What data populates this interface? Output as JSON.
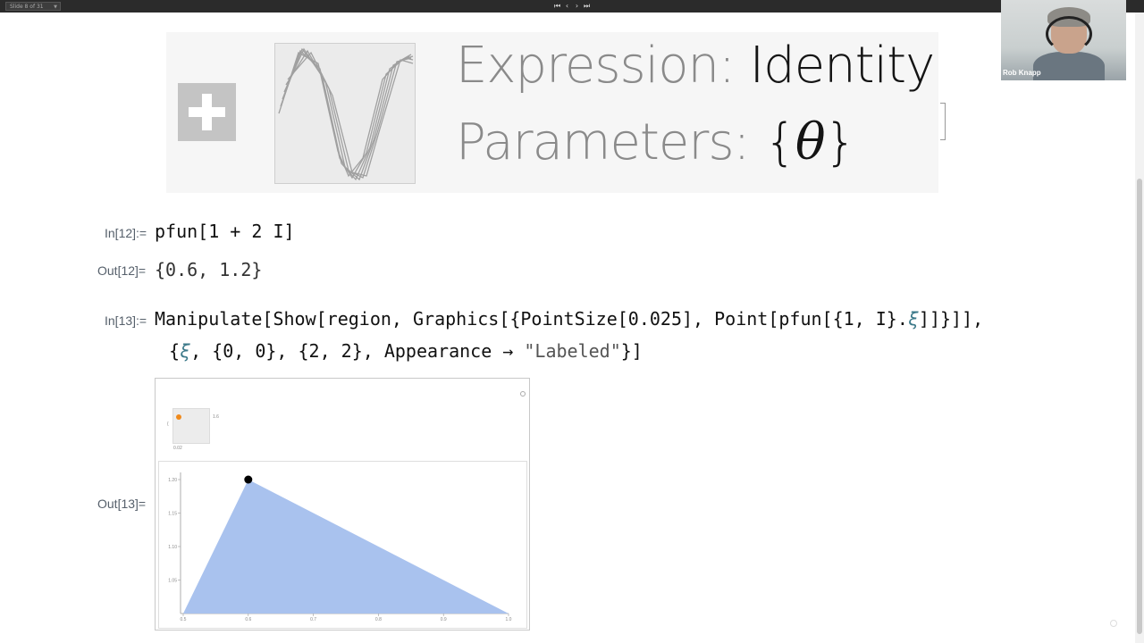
{
  "topbar": {
    "slide_selector": "Slide 8 of 31",
    "nav": [
      "first",
      "previous",
      "next",
      "last"
    ]
  },
  "webcam": {
    "name": "Rob Knapp"
  },
  "banner": {
    "expression_key": "Expression: ",
    "expression_value": "Identity",
    "parameters_key": "Parameters: ",
    "parameters_value_open": "{",
    "parameters_value_symbol": "θ",
    "parameters_value_close": "}"
  },
  "cells": {
    "in12": {
      "label": "In[12]:=",
      "code": "pfun[1 + 2 I]"
    },
    "out12": {
      "label": "Out[12]=",
      "value": "{0.6, 1.2}"
    },
    "in13": {
      "label": "In[13]:=",
      "line1_a": "Manipulate[Show[region, Graphics[{PointSize[0.025], Point[pfun[{1, I}.",
      "line1_xi": "ξ",
      "line1_b": "]]}]],",
      "line2_a": "{",
      "line2_xi": "ξ",
      "line2_b": ", {0, 0}, {2, 2}, Appearance → ",
      "line2_str": "\"Labeled\"",
      "line2_c": "}]"
    },
    "out13": {
      "label": "Out[13]="
    }
  },
  "manipulate": {
    "slider_label_left": "{",
    "slider_value_x": "0.02",
    "slider_value_y": "1.6"
  },
  "chart_data": {
    "type": "area",
    "title": "",
    "xlabel": "",
    "ylabel": "",
    "x_ticks": [
      "0.5",
      "0.6",
      "0.7",
      "0.8",
      "0.9",
      "1.0"
    ],
    "y_ticks": [
      "1.05",
      "1.10",
      "1.15",
      "1.20"
    ],
    "polygon": [
      [
        0.5,
        1.0
      ],
      [
        0.6,
        1.2
      ],
      [
        1.0,
        1.0
      ]
    ],
    "point": [
      0.6,
      1.2
    ],
    "xlim": [
      0.5,
      1.0
    ],
    "ylim": [
      1.0,
      1.2
    ],
    "fill_color": "#a9c2ee",
    "point_color": "#000000"
  },
  "colors": {
    "slider_dot": "#f08a1c",
    "label_gray": "#56606b"
  }
}
